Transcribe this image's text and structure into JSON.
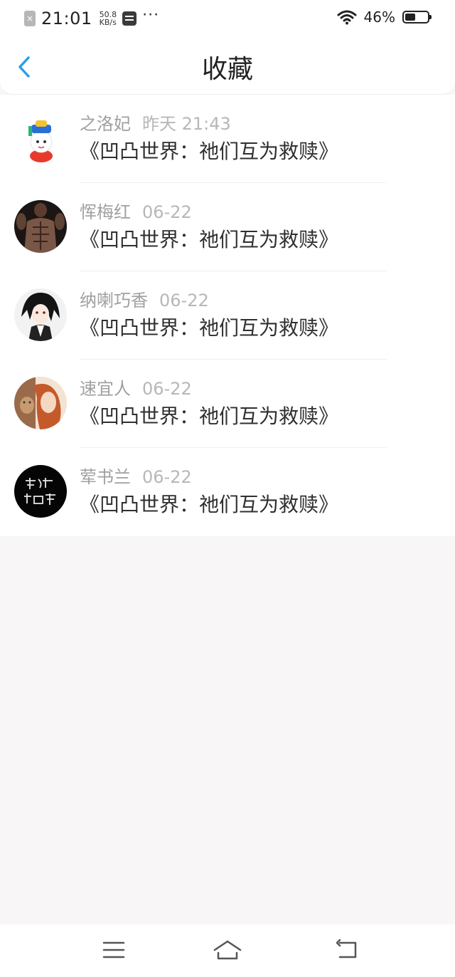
{
  "status_bar": {
    "time": "21:01",
    "net_speed_value": "50.8",
    "net_speed_unit": "KB/s",
    "more": "···",
    "battery_percent": "46%",
    "battery_level": 0.46
  },
  "header": {
    "title": "收藏",
    "back_icon": "chevron-left-icon",
    "accent_color": "#2aa0e8"
  },
  "items": [
    {
      "user": "之洛妃",
      "date": "昨天 21:43",
      "title": "《凹凸世界：祂们互为救赎》"
    },
    {
      "user": "恽梅红",
      "date": "06-22",
      "title": "《凹凸世界：祂们互为救赎》"
    },
    {
      "user": "纳喇巧香",
      "date": "06-22",
      "title": "《凹凸世界：祂们互为救赎》"
    },
    {
      "user": "速宜人",
      "date": "06-22",
      "title": "《凹凸世界：祂们互为救赎》"
    },
    {
      "user": "荤书兰",
      "date": "06-22",
      "title": "《凹凸世界：祂们互为救赎》"
    }
  ],
  "nav": {
    "menu_icon": "menu-icon",
    "home_icon": "home-icon",
    "back_icon": "back-icon"
  }
}
